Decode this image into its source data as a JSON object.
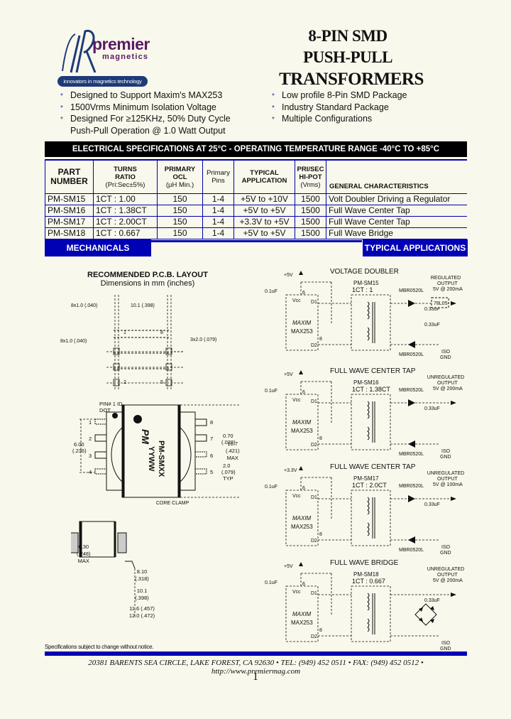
{
  "logo": {
    "brand": "premier",
    "sub": "magnetics",
    "tagline": "innovators in magnetics technology"
  },
  "title": {
    "line1": "8-PIN SMD",
    "line2": "PUSH-PULL",
    "line3": "TRANSFORMERS"
  },
  "features_left": [
    "Designed to Support Maxim's MAX253",
    "1500Vrms Minimum Isolation Voltage",
    "Designed For ≥125KHz, 50% Duty Cycle"
  ],
  "features_left_cont": "Push-Pull Operation @ 1.0 Watt Output",
  "features_right": [
    "Low profile 8-Pin SMD Package",
    "Industry Standard Package",
    "Multiple Configurations"
  ],
  "bullet_glyph": "*",
  "spec": {
    "banner": "ELECTRICAL SPECIFICATIONS AT 25°C - OPERATING TEMPERATURE RANGE  -40°C TO +85°C",
    "headers": [
      [
        "PART",
        "NUMBER"
      ],
      [
        "TURNS",
        "RATIO",
        "(Pri:Sec±5%)"
      ],
      [
        "PRIMARY",
        "OCL",
        "(µH Min.)"
      ],
      [
        "Primary",
        "Pins"
      ],
      [
        "TYPICAL",
        "APPLICATION"
      ],
      [
        "PRI/SEC",
        "HI-POT",
        "(Vrms)"
      ],
      [
        "GENERAL CHARACTERISTICS"
      ]
    ],
    "rows": [
      [
        "PM-SM15",
        "1CT : 1.00",
        "150",
        "1-4",
        "+5V to +10V",
        "1500",
        "Volt Doubler Driving a Regulator"
      ],
      [
        "PM-SM16",
        "1CT : 1.38CT",
        "150",
        "1-4",
        "+5V to +5V",
        "1500",
        "Full Wave Center Tap"
      ],
      [
        "PM-SM17",
        "1CT : 2.00CT",
        "150",
        "1-4",
        "+3.3V to +5V",
        "1500",
        "Full Wave Center Tap"
      ],
      [
        "PM-SM18",
        "1CT : 0.667",
        "150",
        "1-4",
        "+5V to +5V",
        "1500",
        "Full Wave Bridge"
      ]
    ]
  },
  "sections": {
    "mechanicals": "MECHANICALS",
    "applications": "TYPICAL  APPLICATIONS"
  },
  "pcb": {
    "title": "RECOMMENDED  P.C.B.  LAYOUT",
    "subtitle": "Dimensions in mm (inches)",
    "dim_pad_w": "8x1.0 (.040)",
    "dim_span": "10.1 (.398)",
    "dim_pad_h": "8x1.0 (.040)",
    "dim_pitch": "3x2.0 (.079)",
    "pins": [
      "1",
      "8",
      "2",
      "5"
    ]
  },
  "package": {
    "pin1_label": "PIN# 1 ID",
    "pin1_label2": "DOT",
    "marking1": "PM-SMXX",
    "marking2": "YYWW",
    "logo_mark": "PM",
    "left_pins": [
      "1",
      "2",
      "3",
      "4"
    ],
    "right_pins": [
      "8",
      "7",
      "6",
      "5"
    ],
    "dim_width": "6.00",
    "dim_width_in": "(.236)",
    "dim_lead": "0.70",
    "dim_lead_in": "(.028)",
    "dim_pitch": "2.0",
    "dim_pitch_in": "(.079)",
    "dim_pitch_typ": "TYP",
    "dim_len": "10.7",
    "dim_len_in": "(.421)",
    "dim_len_max": "MAX",
    "core_label": "CORE CLAMP"
  },
  "side": {
    "dim_h": "6.30",
    "dim_h_in": "(.248)",
    "dim_h_max": "MAX",
    "dim_a": "8.10",
    "dim_a_in": "(.318)",
    "dim_b": "10.1",
    "dim_b_in": "(.398)",
    "dim_c": "11.6 (.457)",
    "dim_c2": "12.0 (.472)"
  },
  "apps": [
    {
      "title": "VOLTAGE DOUBLER",
      "supply": "+5V",
      "cap_in": "0.1uF",
      "part": "PM-SM15",
      "ratio": "1CT : 1",
      "ic1": "MAXIM",
      "ic2": "MAX253",
      "diode1": "MBR0520L",
      "diode2": "MBR0520L",
      "caps": [
        "0.33uF",
        "0.33uF"
      ],
      "regulator": "78L05",
      "out1": "REGULATED",
      "out2": "OUTPUT",
      "out3": "5V @ 200mA",
      "gnd1": "ISO",
      "gnd2": "GND"
    },
    {
      "title": "FULL WAVE CENTER TAP",
      "supply": "+5V",
      "cap_in": "0.1uF",
      "part": "PM-SM16",
      "ratio": "1CT : 1.38CT",
      "ic1": "MAXIM",
      "ic2": "MAX253",
      "diode1": "MBR0520L",
      "diode2": "MBR0520L",
      "caps": [
        "0.33uF"
      ],
      "out1": "UNREGULATED",
      "out2": "OUTPUT",
      "out3": "5V @ 200mA",
      "gnd1": "ISO",
      "gnd2": "GND"
    },
    {
      "title": "FULL WAVE CENTER TAP",
      "supply": "+3.3V",
      "cap_in": "0.1uF",
      "part": "PM-SM17",
      "ratio": "1CT : 2.0CT",
      "ic1": "MAXIM",
      "ic2": "MAX253",
      "diode1": "MBR0520L",
      "diode2": "MBR0520L",
      "caps": [
        "0.33uF"
      ],
      "out1": "UNREGULATED",
      "out2": "OUTPUT",
      "out3": "5V @ 100mA",
      "gnd1": "ISO",
      "gnd2": "GND"
    },
    {
      "title": "FULL WAVE BRIDGE",
      "supply": "+5V",
      "cap_in": "0.1uF",
      "part": "PM-SM18",
      "ratio": "1CT : 0.667",
      "ic1": "MAXIM",
      "ic2": "MAX253",
      "caps": [
        "0.33uF"
      ],
      "out1": "UNREGULATED",
      "out2": "OUTPUT",
      "out3": "5V @ 200mA",
      "gnd1": "ISO",
      "gnd2": "GND"
    }
  ],
  "ic_pins": {
    "vcc": "Vcc",
    "d1": "D1",
    "d2": "D2",
    "p6": "6",
    "p8": "8"
  },
  "footer": {
    "note": "Specifications subject to change without notice.",
    "address": "20381 BARENTS SEA CIRCLE, LAKE FOREST, CA 92630 • TEL: (949) 452 0511 • FAX: (949) 452 0512 • http://www.premiermag.com",
    "page": "1"
  },
  "colors": {
    "accent_blue": "#0000b4",
    "logo_purple": "#5a1a63",
    "logo_navy": "#1f3a78",
    "background": "#f8f8ec"
  }
}
